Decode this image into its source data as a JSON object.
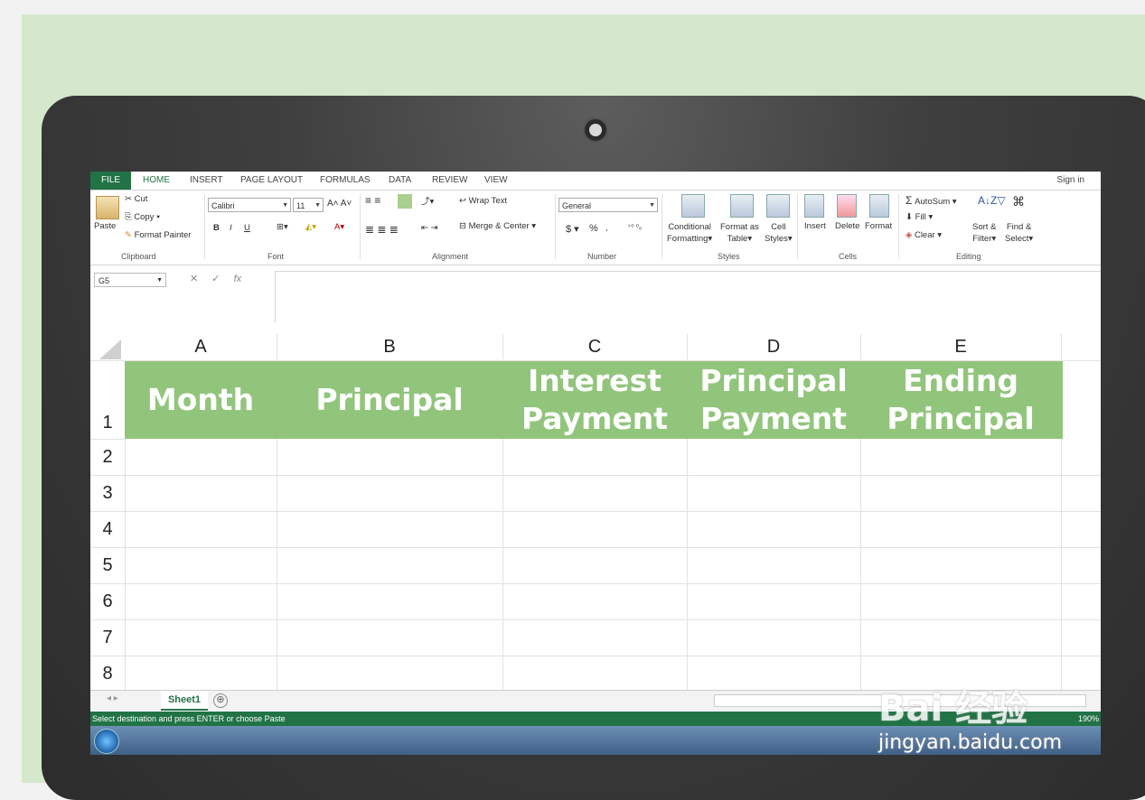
{
  "ribbon_tabs": [
    "FILE",
    "HOME",
    "INSERT",
    "PAGE LAYOUT",
    "FORMULAS",
    "DATA",
    "REVIEW",
    "VIEW"
  ],
  "sign_in": "Sign in",
  "clipboard": {
    "paste": "Paste",
    "cut": "Cut",
    "copy": "Copy",
    "format_painter": "Format Painter",
    "group": "Clipboard"
  },
  "font": {
    "name": "Calibri",
    "size": "11",
    "group": "Font",
    "bold": "B",
    "italic": "I",
    "underline": "U"
  },
  "alignment": {
    "wrap": "Wrap Text",
    "merge": "Merge & Center",
    "group": "Alignment"
  },
  "number": {
    "format": "General",
    "currency": "$",
    "percent": "%",
    "group": "Number"
  },
  "styles": {
    "conditional": "Conditional",
    "conditional2": "Formatting",
    "format_as": "Format as",
    "format_as2": "Table",
    "cell": "Cell",
    "cell2": "Styles",
    "group": "Styles"
  },
  "cells": {
    "insert": "Insert",
    "delete": "Delete",
    "format": "Format",
    "group": "Cells"
  },
  "editing": {
    "autosum": "AutoSum",
    "fill": "Fill",
    "clear": "Clear",
    "sort": "Sort &",
    "sort2": "Filter",
    "find": "Find &",
    "find2": "Select",
    "group": "Editing"
  },
  "name_box": "G5",
  "fx_label": "fx",
  "columns": [
    "A",
    "B",
    "C",
    "D",
    "E"
  ],
  "rows": [
    "1",
    "2",
    "3",
    "4",
    "5",
    "6",
    "7",
    "8"
  ],
  "headers": {
    "a": "Month",
    "b": "Principal",
    "c": "Interest Payment",
    "d": "Principal Payment",
    "e": "Ending Principal"
  },
  "sheet_tab": "Sheet1",
  "add_sheet": "⊕",
  "status_text": "Select destination and press ENTER or choose Paste",
  "zoom": "190%",
  "watermark": {
    "brand": "Bai 经验",
    "url": "jingyan.baidu.com"
  },
  "colors": {
    "excel_green": "#217346",
    "header_fill": "#92c57c",
    "background": "#d6e8cc"
  }
}
